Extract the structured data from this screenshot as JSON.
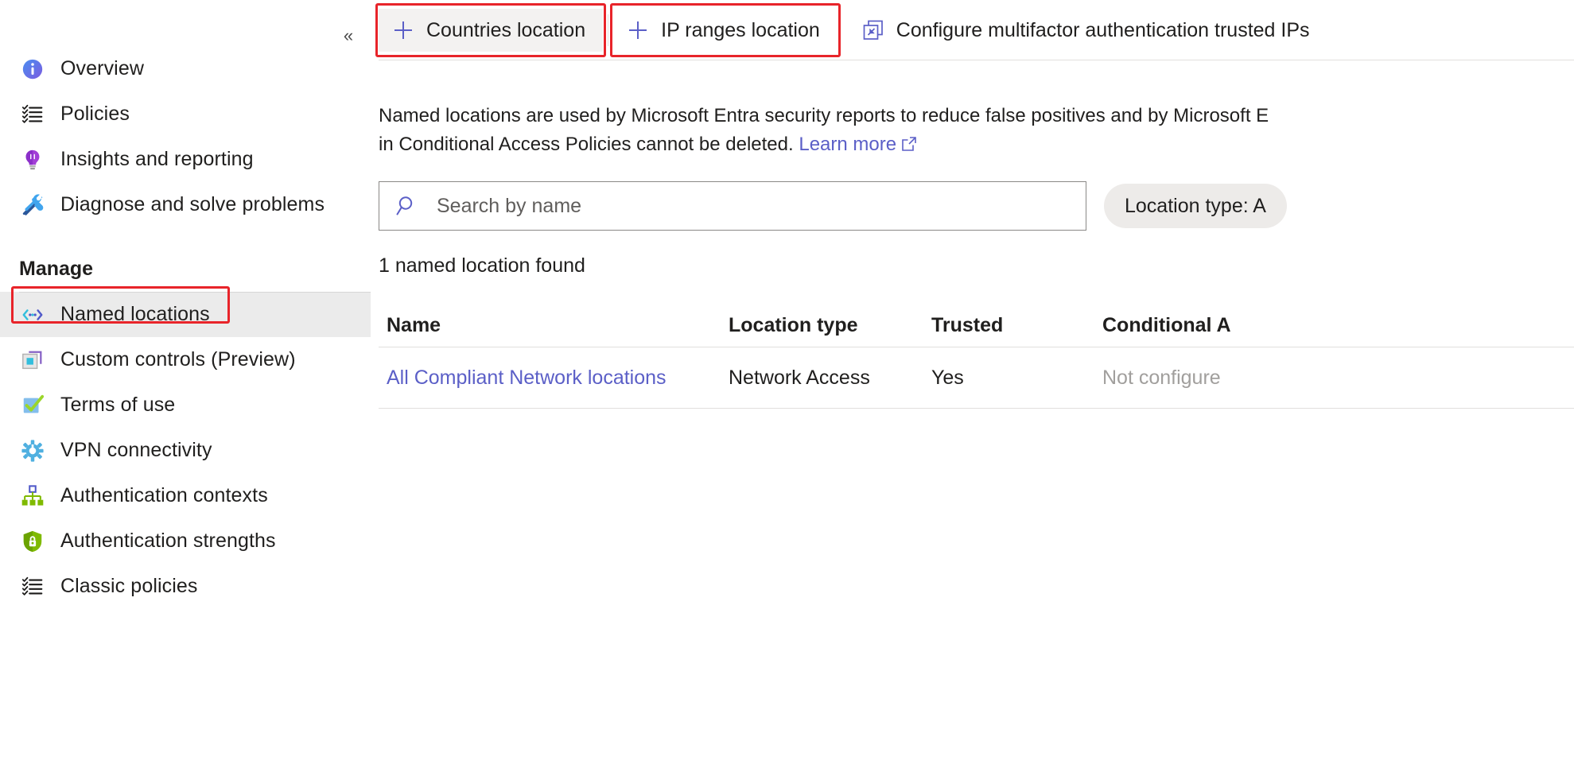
{
  "sidebar": {
    "collapse_glyph": "«",
    "items": [
      {
        "label": "Overview",
        "icon": "info-icon"
      },
      {
        "label": "Policies",
        "icon": "checklist-icon"
      },
      {
        "label": "Insights and reporting",
        "icon": "lightbulb-icon"
      },
      {
        "label": "Diagnose and solve problems",
        "icon": "wrench-screwdriver-icon"
      }
    ],
    "section_title": "Manage",
    "manage_items": [
      {
        "label": "Named locations",
        "icon": "named-locations-icon",
        "selected": true
      },
      {
        "label": "Custom controls (Preview)",
        "icon": "custom-controls-icon",
        "selected": false
      },
      {
        "label": "Terms of use",
        "icon": "terms-of-use-icon",
        "selected": false
      },
      {
        "label": "VPN connectivity",
        "icon": "vpn-gear-icon",
        "selected": false
      },
      {
        "label": "Authentication contexts",
        "icon": "hierarchy-icon",
        "selected": false
      },
      {
        "label": "Authentication strengths",
        "icon": "shield-lock-icon",
        "selected": false
      },
      {
        "label": "Classic policies",
        "icon": "checklist-icon",
        "selected": false
      }
    ]
  },
  "toolbar": {
    "countries_location": "Countries location",
    "ip_ranges_location": "IP ranges location",
    "configure_trusted_ips": "Configure multifactor authentication trusted IPs",
    "plus_icon": "plus-icon",
    "external_link_icon": "external-link-icon"
  },
  "description": {
    "line1": "Named locations are used by Microsoft Entra security reports to reduce false positives and by Microsoft E",
    "line2": "in Conditional Access Policies cannot be deleted.",
    "learn_more": "Learn more"
  },
  "search": {
    "placeholder": "Search by name",
    "value": "",
    "icon": "search-icon"
  },
  "filter": {
    "location_type_pill": "Location type: A"
  },
  "results": {
    "count_text": "1 named location found"
  },
  "table": {
    "columns": [
      "Name",
      "Location type",
      "Trusted",
      "Conditional A"
    ],
    "rows": [
      {
        "name": "All Compliant Network locations",
        "location_type": "Network Access",
        "trusted": "Yes",
        "conditional_access": "Not configure"
      }
    ]
  },
  "colors": {
    "highlight": "#e8242a",
    "link": "#5b5fc7",
    "selected_nav_bg": "#ebebeb",
    "pill_bg": "#edebe9"
  }
}
